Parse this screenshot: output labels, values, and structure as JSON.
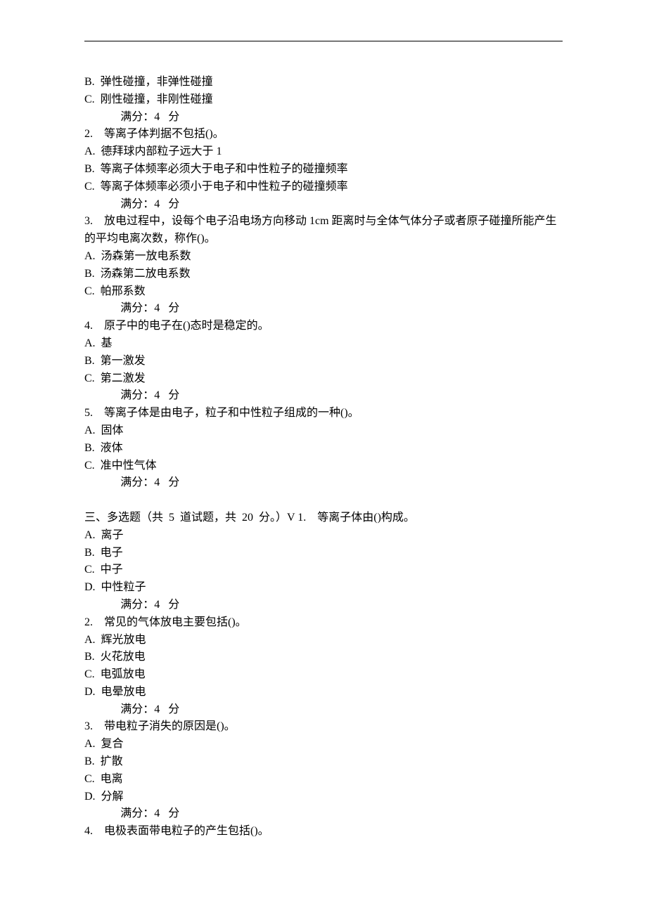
{
  "rule": "_______________________________________________________________________________",
  "lines": [
    {
      "cls": "line",
      "t": "B.  弹性碰撞，非弹性碰撞"
    },
    {
      "cls": "line",
      "t": "C.  刚性碰撞，非刚性碰撞"
    },
    {
      "cls": "line indent-score",
      "t": "满分：4   分"
    },
    {
      "cls": "line",
      "t": "2.    等离子体判据不包括()。"
    },
    {
      "cls": "line",
      "t": "A.  德拜球内部粒子远大于 1"
    },
    {
      "cls": "line",
      "t": "B.  等离子体频率必须大于电子和中性粒子的碰撞频率"
    },
    {
      "cls": "line",
      "t": "C.  等离子体频率必须小于电子和中性粒子的碰撞频率"
    },
    {
      "cls": "line indent-score",
      "t": "满分：4   分"
    },
    {
      "cls": "line",
      "t": "3.    放电过程中，设每个电子沿电场方向移动 1cm 距离时与全体气体分子或者原子碰撞所能产生的平均电离次数，称作()。"
    },
    {
      "cls": "line",
      "t": "A.  汤森第一放电系数"
    },
    {
      "cls": "line",
      "t": "B.  汤森第二放电系数"
    },
    {
      "cls": "line",
      "t": "C.  帕邢系数"
    },
    {
      "cls": "line indent-score",
      "t": "满分：4   分"
    },
    {
      "cls": "line",
      "t": "4.    原子中的电子在()态时是稳定的。"
    },
    {
      "cls": "line",
      "t": "A.  基"
    },
    {
      "cls": "line",
      "t": "B.  第一激发"
    },
    {
      "cls": "line",
      "t": "C.  第二激发"
    },
    {
      "cls": "line indent-score",
      "t": "满分：4   分"
    },
    {
      "cls": "line",
      "t": "5.    等离子体是由电子，粒子和中性粒子组成的一种()。"
    },
    {
      "cls": "line",
      "t": "A.  固体"
    },
    {
      "cls": "line",
      "t": "B.  液体"
    },
    {
      "cls": "line",
      "t": "C.  准中性气体"
    },
    {
      "cls": "line indent-score",
      "t": "满分：4   分"
    },
    {
      "cls": "section-gap",
      "t": ""
    },
    {
      "cls": "line",
      "t": "三、多选题（共  5  道试题，共  20  分。）V 1.    等离子体由()构成。"
    },
    {
      "cls": "line",
      "t": "A.  离子"
    },
    {
      "cls": "line",
      "t": "B.  电子"
    },
    {
      "cls": "line",
      "t": "C.  中子"
    },
    {
      "cls": "line",
      "t": "D.  中性粒子"
    },
    {
      "cls": "line indent-score",
      "t": "满分：4   分"
    },
    {
      "cls": "line",
      "t": "2.    常见的气体放电主要包括()。"
    },
    {
      "cls": "line",
      "t": "A.  辉光放电"
    },
    {
      "cls": "line",
      "t": "B.  火花放电"
    },
    {
      "cls": "line",
      "t": "C.  电弧放电"
    },
    {
      "cls": "line",
      "t": "D.  电晕放电"
    },
    {
      "cls": "line indent-score",
      "t": "满分：4   分"
    },
    {
      "cls": "line",
      "t": "3.    带电粒子消失的原因是()。"
    },
    {
      "cls": "line",
      "t": "A.  复合"
    },
    {
      "cls": "line",
      "t": "B.  扩散"
    },
    {
      "cls": "line",
      "t": "C.  电离"
    },
    {
      "cls": "line",
      "t": "D.  分解"
    },
    {
      "cls": "line indent-score",
      "t": "满分：4   分"
    },
    {
      "cls": "line",
      "t": "4.    电极表面带电粒子的产生包括()。"
    }
  ]
}
